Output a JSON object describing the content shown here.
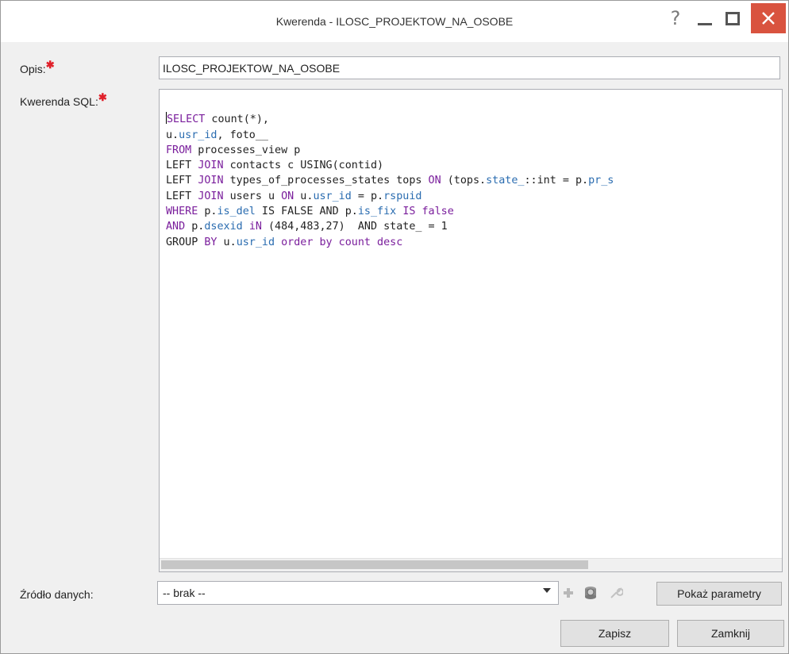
{
  "window": {
    "title": "Kwerenda - ILOSC_PROJEKTOW_NA_OSOBE",
    "help_glyph": "?"
  },
  "form": {
    "opis_label": "Opis:",
    "opis_value": "ILOSC_PROJEKTOW_NA_OSOBE",
    "sql_label": "Kwerenda SQL:",
    "required_marker": "✱",
    "sql_lines": [
      "SELECT count(*),",
      "u.usr_id, foto__",
      "FROM processes_view p",
      "LEFT JOIN contacts c USING(contid)",
      "LEFT JOIN types_of_processes_states tops ON (tops.state_::int = p.pr_s",
      "LEFT JOIN users u ON u.usr_id = p.rspuid",
      "WHERE p.is_del IS FALSE AND p.is_fix IS false",
      "AND p.dsexid iN (484,483,27)  AND state_ = 1",
      "GROUP BY u.usr_id order by count desc"
    ],
    "source_label": "Źródło danych:",
    "source_value": "-- brak --"
  },
  "buttons": {
    "show_params": "Pokaż parametry",
    "save": "Zapisz",
    "close": "Zamknij"
  },
  "icons": [
    "plus-icon",
    "database-icon",
    "wrench-icon"
  ],
  "colors": {
    "keyword": "#7a1e9c",
    "field": "#2a6cb0",
    "close_button": "#d9533f",
    "required": "#e0202a"
  }
}
